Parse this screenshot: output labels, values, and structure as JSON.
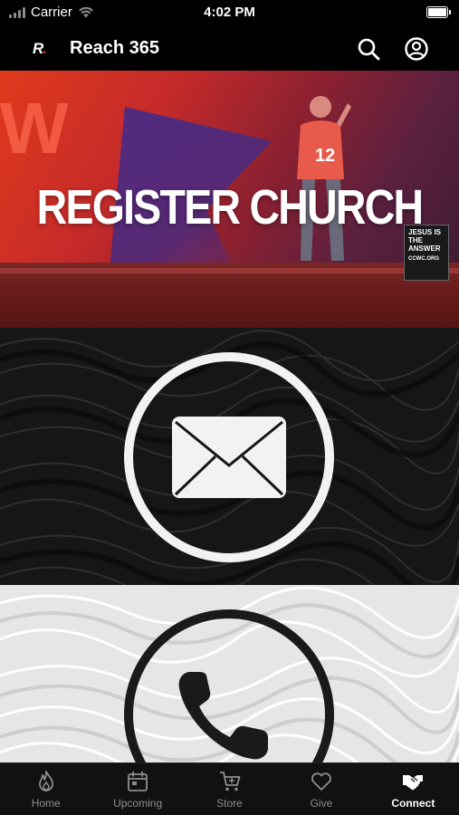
{
  "status_bar": {
    "carrier": "Carrier",
    "time": "4:02 PM",
    "battery_level": 1.0
  },
  "header": {
    "logo_text": "R",
    "logo_accent": ".",
    "title": "Reach 365",
    "icons": [
      "search-icon",
      "account-icon"
    ]
  },
  "hero": {
    "title": "REGISTER CHURCH",
    "sign_text": "JESUS IS THE ANSWER",
    "sign_url": "CCWC.ORG"
  },
  "sections": {
    "email": {
      "icon": "envelope-icon"
    },
    "phone": {
      "icon": "phone-icon"
    }
  },
  "tabs": [
    {
      "label": "Home",
      "icon": "flame-icon",
      "active": false
    },
    {
      "label": "Upcoming",
      "icon": "calendar-icon",
      "active": false
    },
    {
      "label": "Store",
      "icon": "cart-icon",
      "active": false
    },
    {
      "label": "Give",
      "icon": "heart-icon",
      "active": false
    },
    {
      "label": "Connect",
      "icon": "handshake-icon",
      "active": true
    }
  ],
  "colors": {
    "accent": "#e0262a",
    "background": "#000000",
    "tab_inactive": "#8e8e8e",
    "tab_active": "#ffffff"
  }
}
